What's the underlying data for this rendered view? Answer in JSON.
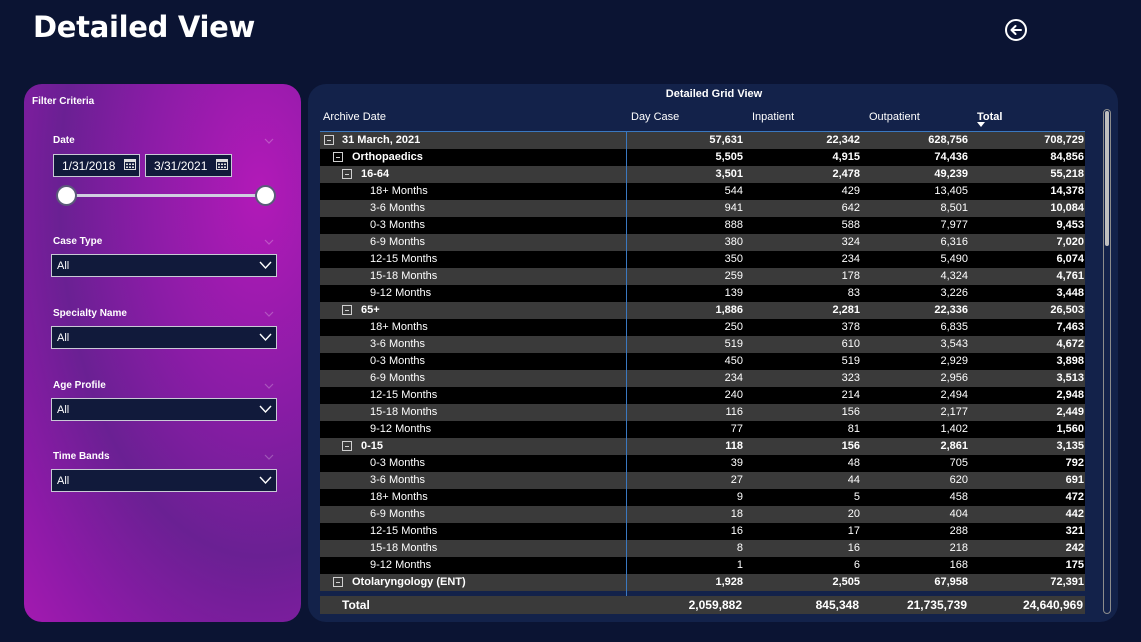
{
  "page": {
    "title": "Detailed View",
    "back_icon": "back-arrow-circle-icon"
  },
  "filters": {
    "title": "Filter Criteria",
    "date": {
      "label": "Date",
      "start": "1/31/2018",
      "end": "3/31/2021"
    },
    "case_type": {
      "label": "Case Type",
      "value": "All"
    },
    "specialty_name": {
      "label": "Specialty Name",
      "value": "All"
    },
    "age_profile": {
      "label": "Age Profile",
      "value": "All"
    },
    "time_bands": {
      "label": "Time Bands",
      "value": "All"
    }
  },
  "grid": {
    "title": "Detailed Grid View",
    "columns": [
      "Archive Date",
      "Day Case",
      "Inpatient",
      "Outpatient",
      "Total"
    ],
    "sorted_column": "Total",
    "rows": [
      {
        "label": "31 March, 2021",
        "level": 0,
        "expander": true,
        "bold": true,
        "values": [
          "57,631",
          "22,342",
          "628,756",
          "708,729"
        ]
      },
      {
        "label": "Orthopaedics",
        "level": 1,
        "expander": true,
        "bold": true,
        "values": [
          "5,505",
          "4,915",
          "74,436",
          "84,856"
        ]
      },
      {
        "label": "16-64",
        "level": 2,
        "expander": true,
        "bold": true,
        "values": [
          "3,501",
          "2,478",
          "49,239",
          "55,218"
        ]
      },
      {
        "label": "18+ Months",
        "level": 3,
        "values": [
          "544",
          "429",
          "13,405",
          "14,378"
        ]
      },
      {
        "label": "3-6 Months",
        "level": 3,
        "values": [
          "941",
          "642",
          "8,501",
          "10,084"
        ]
      },
      {
        "label": "0-3 Months",
        "level": 3,
        "values": [
          "888",
          "588",
          "7,977",
          "9,453"
        ]
      },
      {
        "label": "6-9 Months",
        "level": 3,
        "values": [
          "380",
          "324",
          "6,316",
          "7,020"
        ]
      },
      {
        "label": "12-15 Months",
        "level": 3,
        "values": [
          "350",
          "234",
          "5,490",
          "6,074"
        ]
      },
      {
        "label": "15-18 Months",
        "level": 3,
        "values": [
          "259",
          "178",
          "4,324",
          "4,761"
        ]
      },
      {
        "label": "9-12 Months",
        "level": 3,
        "values": [
          "139",
          "83",
          "3,226",
          "3,448"
        ]
      },
      {
        "label": "65+",
        "level": 2,
        "expander": true,
        "bold": true,
        "values": [
          "1,886",
          "2,281",
          "22,336",
          "26,503"
        ]
      },
      {
        "label": "18+ Months",
        "level": 3,
        "values": [
          "250",
          "378",
          "6,835",
          "7,463"
        ]
      },
      {
        "label": "3-6 Months",
        "level": 3,
        "values": [
          "519",
          "610",
          "3,543",
          "4,672"
        ]
      },
      {
        "label": "0-3 Months",
        "level": 3,
        "values": [
          "450",
          "519",
          "2,929",
          "3,898"
        ]
      },
      {
        "label": "6-9 Months",
        "level": 3,
        "values": [
          "234",
          "323",
          "2,956",
          "3,513"
        ]
      },
      {
        "label": "12-15 Months",
        "level": 3,
        "values": [
          "240",
          "214",
          "2,494",
          "2,948"
        ]
      },
      {
        "label": "15-18 Months",
        "level": 3,
        "values": [
          "116",
          "156",
          "2,177",
          "2,449"
        ]
      },
      {
        "label": "9-12 Months",
        "level": 3,
        "values": [
          "77",
          "81",
          "1,402",
          "1,560"
        ]
      },
      {
        "label": "0-15",
        "level": 2,
        "expander": true,
        "bold": true,
        "values": [
          "118",
          "156",
          "2,861",
          "3,135"
        ]
      },
      {
        "label": "0-3 Months",
        "level": 3,
        "values": [
          "39",
          "48",
          "705",
          "792"
        ]
      },
      {
        "label": "3-6 Months",
        "level": 3,
        "values": [
          "27",
          "44",
          "620",
          "691"
        ]
      },
      {
        "label": "18+ Months",
        "level": 3,
        "values": [
          "9",
          "5",
          "458",
          "472"
        ]
      },
      {
        "label": "6-9 Months",
        "level": 3,
        "values": [
          "18",
          "20",
          "404",
          "442"
        ]
      },
      {
        "label": "12-15 Months",
        "level": 3,
        "values": [
          "16",
          "17",
          "288",
          "321"
        ]
      },
      {
        "label": "15-18 Months",
        "level": 3,
        "values": [
          "8",
          "16",
          "218",
          "242"
        ]
      },
      {
        "label": "9-12 Months",
        "level": 3,
        "values": [
          "1",
          "6",
          "168",
          "175"
        ]
      },
      {
        "label": "Otolaryngology (ENT)",
        "level": 1,
        "expander": true,
        "bold": true,
        "values": [
          "1,928",
          "2,505",
          "67,958",
          "72,391"
        ]
      }
    ],
    "total": {
      "label": "Total",
      "values": [
        "2,059,882",
        "845,348",
        "21,735,739",
        "24,640,969"
      ]
    }
  }
}
